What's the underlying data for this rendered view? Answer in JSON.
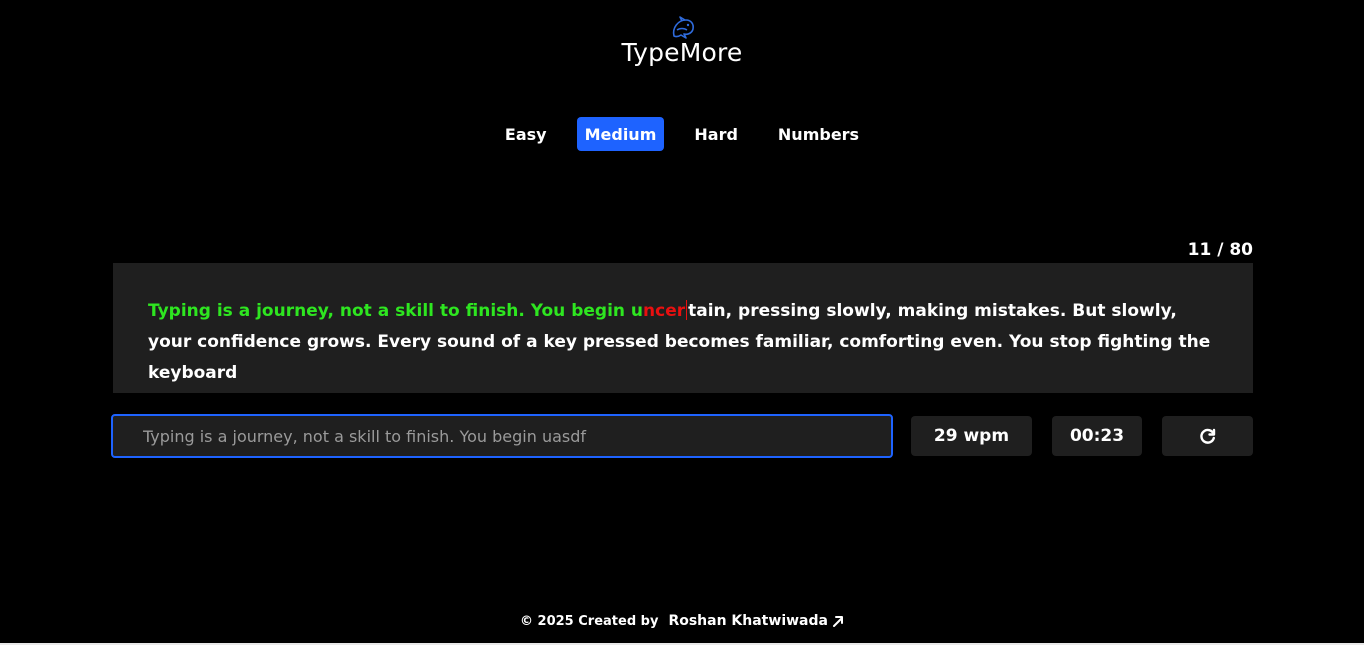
{
  "header": {
    "logo_icon": "dolphin-icon",
    "title": "TypeMore"
  },
  "tabs": [
    {
      "label": "Easy",
      "active": false
    },
    {
      "label": "Medium",
      "active": true
    },
    {
      "label": "Hard",
      "active": false
    },
    {
      "label": "Numbers",
      "active": false
    }
  ],
  "progress": {
    "text": "11 / 80",
    "current": 11,
    "total": 80
  },
  "passage": {
    "correct": "Typing is a journey, not a skill to finish. You begin u",
    "wrong": "ncer",
    "remaining": "tain, pressing slowly, making mistakes. But slowly, your confidence grows. Every sound of a key pressed becomes familiar, comforting even. You stop fighting the keyboard"
  },
  "input": {
    "value": "Typing is a journey, not a skill to finish. You begin uasdf"
  },
  "stats": {
    "wpm": "29 wpm",
    "timer": "00:23",
    "reset_icon": "refresh-icon"
  },
  "footer": {
    "copyright": "© 2025 Created by",
    "author": "Roshan Khatwiwada",
    "author_icon": "arrow-up-right-icon"
  },
  "colors": {
    "background": "#000000",
    "panel": "#1f1f1f",
    "accent": "#1e63ff",
    "correct": "#2ee620",
    "wrong": "#e81010"
  }
}
